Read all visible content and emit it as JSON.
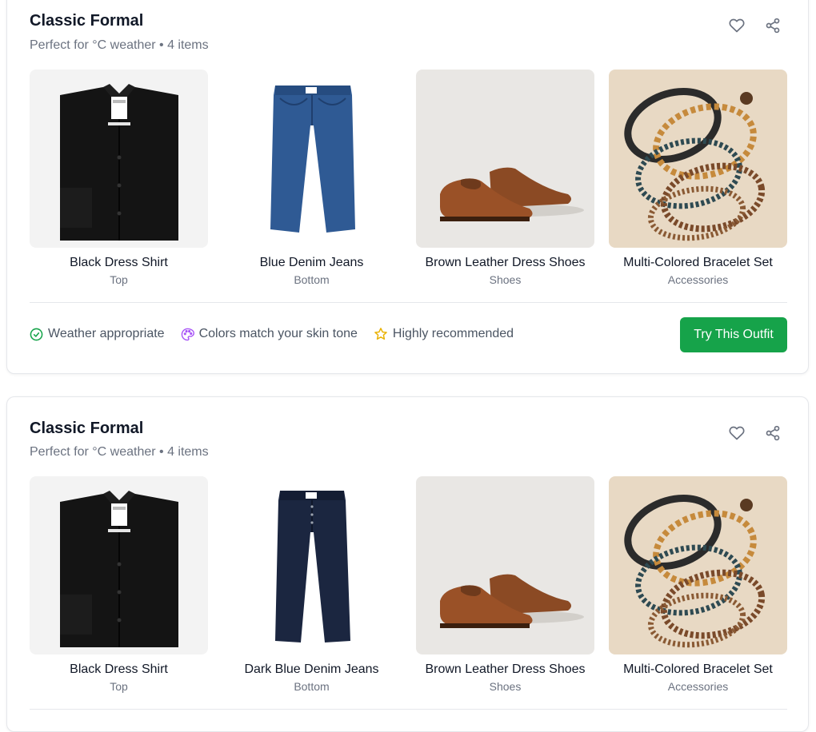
{
  "outfits": [
    {
      "title": "Classic Formal",
      "subtitle": "Perfect for °C weather • 4 items",
      "items": [
        {
          "name": "Black Dress Shirt",
          "category": "Top",
          "image": "black-dress-shirt-image"
        },
        {
          "name": "Blue Denim Jeans",
          "category": "Bottom",
          "image": "blue-denim-jeans-image"
        },
        {
          "name": "Brown Leather Dress Shoes",
          "category": "Shoes",
          "image": "brown-leather-shoes-image"
        },
        {
          "name": "Multi-Colored Bracelet Set",
          "category": "Accessories",
          "image": "bracelet-set-image"
        }
      ],
      "features": [
        {
          "label": "Weather appropriate",
          "icon": "check-circle-icon",
          "color": "#16a34a"
        },
        {
          "label": "Colors match your skin tone",
          "icon": "palette-icon",
          "color": "#a855f7"
        },
        {
          "label": "Highly recommended",
          "icon": "star-icon",
          "color": "#eab308"
        }
      ],
      "cta_label": "Try This Outfit"
    },
    {
      "title": "Classic Formal",
      "subtitle": "Perfect for °C weather • 4 items",
      "items": [
        {
          "name": "Black Dress Shirt",
          "category": "Top",
          "image": "black-dress-shirt-image"
        },
        {
          "name": "Dark Blue Denim Jeans",
          "category": "Bottom",
          "image": "dark-blue-denim-jeans-image"
        },
        {
          "name": "Brown Leather Dress Shoes",
          "category": "Shoes",
          "image": "brown-leather-shoes-image"
        },
        {
          "name": "Multi-Colored Bracelet Set",
          "category": "Accessories",
          "image": "bracelet-set-image"
        }
      ]
    }
  ],
  "colors": {
    "accent": "#16a34a",
    "muted_text": "#6b7280",
    "border": "#e5e7eb"
  }
}
